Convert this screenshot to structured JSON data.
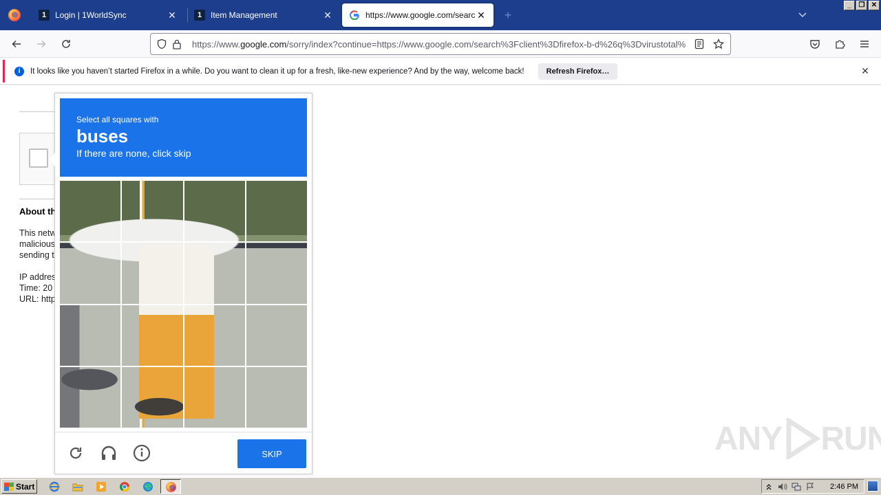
{
  "tabs": [
    {
      "title": "Login | 1WorldSync",
      "favicon": "1worldsync-icon"
    },
    {
      "title": "Item Management",
      "favicon": "1worldsync-icon"
    },
    {
      "title": "https://www.google.com/search?c",
      "favicon": "google-icon",
      "active": true
    }
  ],
  "favicon_text": {
    "oneworldsync": "1",
    "google": "G"
  },
  "window_controls": {
    "minimize": "_",
    "restore": "❐",
    "close": "✕"
  },
  "urlbar": {
    "url_prefix": "https://www.",
    "url_domain": "google.com",
    "url_rest": "/sorry/index?continue=https://www.google.com/search%3Fclient%3Dfirefox-b-d%26q%3Dvirustotal%"
  },
  "notification": {
    "message": "It looks like you haven’t started Firefox in a while. Do you want to clean it up for a fresh, like-new experience? And by the way, welcome back!",
    "button": "Refresh Firefox…",
    "info_glyph": "i",
    "close_glyph": "✕"
  },
  "background_page": {
    "heading": "About th",
    "paragraph_lines": [
      "This netw",
      "malicious",
      "sending t"
    ],
    "details_lines": [
      "IP addres",
      "Time: 20",
      "URL: http"
    ]
  },
  "captcha": {
    "instruction": "Select all squares with",
    "target": "buses",
    "hint": "If there are none, click skip",
    "skip_label": "SKIP",
    "footer_icons": [
      "reload-icon",
      "audio-challenge-icon",
      "info-icon"
    ],
    "accent_color": "#1a73e8"
  },
  "watermark": {
    "text_left": "ANY",
    "text_right": "RUN"
  },
  "taskbar": {
    "start_label": "Start",
    "pinned": [
      "internet-explorer-icon",
      "file-explorer-icon",
      "media-player-icon",
      "chrome-icon",
      "edge-icon",
      "firefox-icon"
    ],
    "clock": "2:46 PM"
  }
}
